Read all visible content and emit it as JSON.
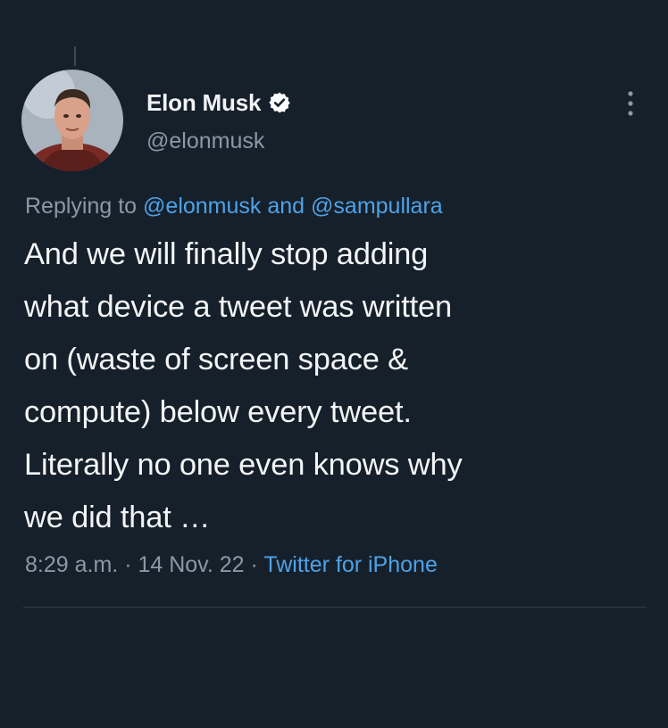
{
  "author": {
    "display_name": "Elon Musk",
    "handle": "@elonmusk",
    "verified": true
  },
  "reply": {
    "prefix": "Replying to",
    "mention_1": "@elonmusk",
    "conjunction": "and",
    "mention_2": "@sampullara"
  },
  "tweet": {
    "lines": [
      "And we will finally stop adding",
      "what device a tweet was written",
      "on (waste of screen space &",
      "compute) below every tweet.",
      "Literally no one even knows why",
      "we did that …"
    ]
  },
  "meta": {
    "time": "8:29 a.m.",
    "separator": "·",
    "date": "14 Nov. 22",
    "source": "Twitter for iPhone"
  },
  "icons": {
    "verified": "verified-badge-icon",
    "more": "more-vertical-icon"
  },
  "colors": {
    "background": "#16202b",
    "link": "#4ea2e7",
    "secondary_text": "#8b98a5",
    "primary_text": "#f2f4f5"
  }
}
